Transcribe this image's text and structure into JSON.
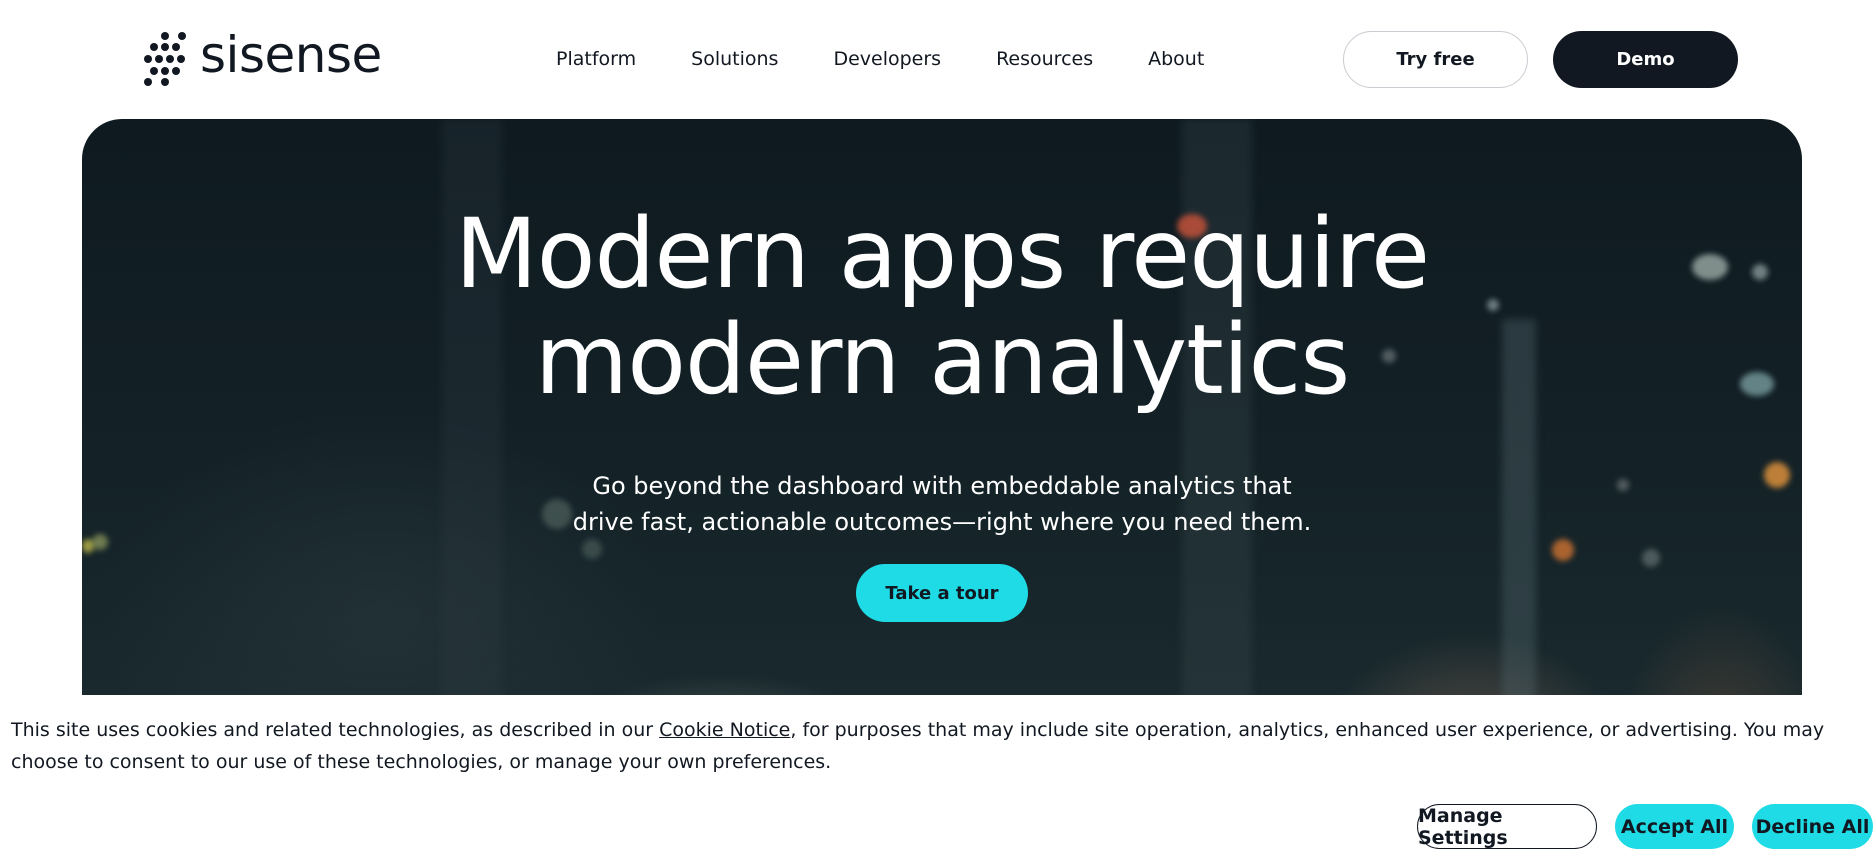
{
  "brand": {
    "name": "sisense",
    "logo_icon": "dot-grid-icon"
  },
  "nav": {
    "items": [
      "Platform",
      "Solutions",
      "Developers",
      "Resources",
      "About"
    ]
  },
  "header": {
    "try_free_label": "Try free",
    "demo_label": "Demo"
  },
  "hero": {
    "title_line1": "Modern apps require",
    "title_line2": "modern analytics",
    "subtitle_line1": "Go beyond the dashboard with embeddable analytics that",
    "subtitle_line2": "drive fast, actionable outcomes—right where you need them.",
    "cta_label": "Take a tour"
  },
  "cookie_banner": {
    "text_before": "This site uses cookies and related technologies, as described in our ",
    "link_text": "Cookie Notice",
    "text_after": ", for purposes that may include site operation, analytics, enhanced user experience, or advertising. You may choose to consent to our use of these technologies, or manage your own preferences.",
    "manage_label": "Manage Settings",
    "accept_label": "Accept All",
    "decline_label": "Decline All"
  },
  "colors": {
    "accent": "#1fdbe5",
    "dark": "#121821",
    "white": "#ffffff"
  }
}
